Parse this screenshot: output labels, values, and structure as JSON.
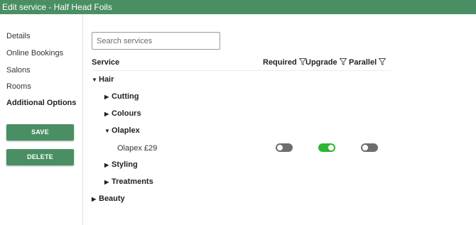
{
  "window": {
    "title": "Edit service - Half Head Foils"
  },
  "sidebar": {
    "items": [
      {
        "label": "Details"
      },
      {
        "label": "Online Bookings"
      },
      {
        "label": "Salons"
      },
      {
        "label": "Rooms"
      },
      {
        "label": "Additional Options",
        "active": true
      }
    ],
    "save_label": "SAVE",
    "delete_label": "DELETE"
  },
  "search": {
    "placeholder": "Search services",
    "value": ""
  },
  "table": {
    "headers": {
      "service": "Service",
      "required": "Required",
      "upgrade": "Upgrade",
      "parallel": "Parallel"
    },
    "tree": {
      "hair": "Hair",
      "cutting": "Cutting",
      "colours": "Colours",
      "olaplex": "Olaplex",
      "olaplex_item": {
        "name": "Olapex £29",
        "required": false,
        "upgrade": true,
        "parallel": false
      },
      "styling": "Styling",
      "treatments": "Treatments",
      "beauty": "Beauty"
    }
  },
  "colors": {
    "brand": "#4a8f63",
    "toggle_on": "#2db534",
    "toggle_off": "#6e6e6e"
  },
  "icons": {
    "filter": "filter-icon",
    "expand": "caret-right-icon",
    "collapse": "caret-down-icon"
  }
}
